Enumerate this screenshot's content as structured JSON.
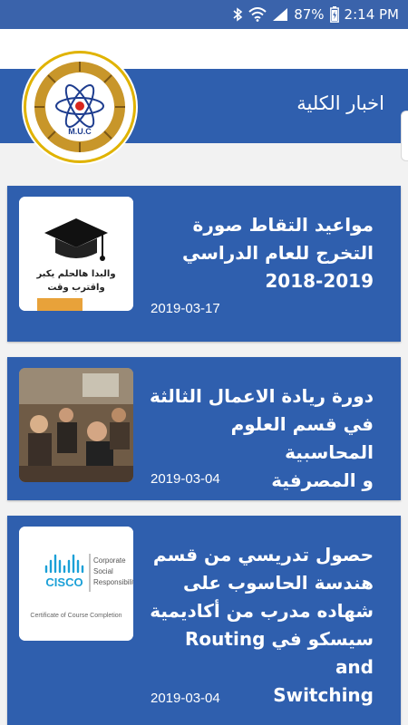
{
  "status_bar": {
    "battery_percent": "87%",
    "time": "2:14 PM"
  },
  "header": {
    "title": "اخبار الكلية"
  },
  "logo": {
    "text_top": "كلية المنصور الجامعة",
    "abbreviation": "M.U.C"
  },
  "news": [
    {
      "title_lines": [
        "مواعيد التقاط صورة",
        "التخرج للعام الدراسي",
        "2018-2019"
      ],
      "date": "2019-03-17",
      "thumb": "graduation-cap",
      "thumb_caption_1": "والبدا هالحلم يكبر",
      "thumb_caption_2": "واقترب وقت"
    },
    {
      "title_lines": [
        "دورة ريادة الاعمال الثالثة",
        "في قسم العلوم المحاسبية",
        "و المصرفية"
      ],
      "date": "2019-03-04",
      "thumb": "classroom-photo"
    },
    {
      "title_lines": [
        "حصول تدريسي من قسم",
        "هندسة الحاسوب على",
        "شهاده مدرب من أكاديمية",
        "سيسكو في Routing and",
        "Switching"
      ],
      "date": "2019-03-04",
      "thumb": "cisco-certificate",
      "thumb_text": {
        "brand": "CISCO",
        "line1": "Corporate",
        "line2": "Social",
        "line3": "Responsibility",
        "footer": "Certificate of Course Completion"
      }
    }
  ]
}
